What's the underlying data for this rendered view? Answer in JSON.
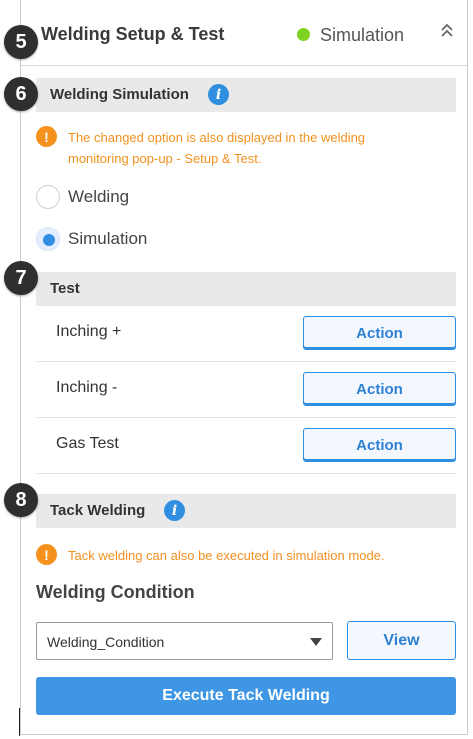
{
  "markers": [
    "5",
    "6",
    "7",
    "8"
  ],
  "header": {
    "title": "Welding Setup & Test",
    "status_label": "Simulation",
    "status_color": "#7ed321",
    "collapse_icon": "double-chevron-up-icon"
  },
  "welding_simulation": {
    "title": "Welding Simulation",
    "info_icon": "info-icon",
    "notice_line1": "The changed option is also displayed in the welding",
    "notice_line2": "monitoring pop-up - Setup & Test.",
    "options": [
      {
        "label": "Welding",
        "checked": false
      },
      {
        "label": "Simulation",
        "checked": true
      }
    ]
  },
  "test": {
    "title": "Test",
    "rows": [
      {
        "label": "Inching +",
        "action": "Action"
      },
      {
        "label": "Inching -",
        "action": "Action"
      },
      {
        "label": "Gas Test",
        "action": "Action"
      }
    ]
  },
  "tack_welding": {
    "title": "Tack Welding",
    "info_icon": "info-icon",
    "notice": "Tack welding can also be executed in simulation mode.",
    "condition_heading": "Welding Condition",
    "condition_value": "Welding_Condition",
    "view_label": "View",
    "execute_label": "Execute Tack Welding"
  },
  "colors": {
    "accent": "#2f8ee0",
    "warning": "#f29120",
    "execute": "#3f96e4"
  }
}
